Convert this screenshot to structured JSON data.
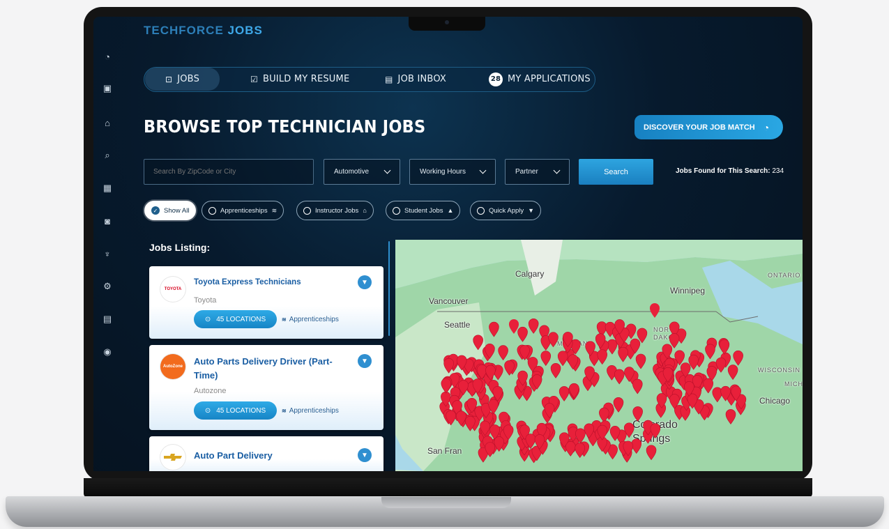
{
  "app": {
    "brand_prefix": "TECHFORCE",
    "brand_suffix": "JOBS"
  },
  "tabs": [
    {
      "label": "JOBS",
      "icon": "briefcase-icon",
      "active": true
    },
    {
      "label": "BUILD MY RESUME",
      "icon": "resume-edit-icon"
    },
    {
      "label": "JOB INBOX",
      "icon": "message-icon"
    },
    {
      "label": "MY APPLICATIONS",
      "badge": "28"
    }
  ],
  "page": {
    "title": "BROWSE TOP TECHNICIAN JOBS",
    "match_button": "DISCOVER YOUR JOB MATCH"
  },
  "filters": {
    "search_placeholder": "Search By ZipCode or City",
    "category": "Automotive",
    "hours": "Working Hours",
    "partner": "Partner",
    "search_button": "Search",
    "found_label": "Jobs Found for This Search:",
    "found_count": "234"
  },
  "chips": [
    {
      "label": "Show All",
      "active": true
    },
    {
      "label": "Apprenticeships"
    },
    {
      "label": "Instructor Jobs"
    },
    {
      "label": "Student Jobs"
    },
    {
      "label": "Quick Apply"
    }
  ],
  "listing": {
    "title": "Jobs Listing:",
    "jobs": [
      {
        "title": "Toyota Express Technicians",
        "company": "Toyota",
        "locations": "45 LOCATIONS",
        "tag": "Apprenticeships",
        "logo_text": "TOYOTA"
      },
      {
        "title": "Auto Parts Delivery Driver (Part-Time)",
        "company": "Autozone",
        "locations": "45 LOCATIONS",
        "tag": "Apprenticeships",
        "logo_text": "AutoZone"
      },
      {
        "title": "Auto Part Delivery",
        "company": "",
        "locations": "",
        "tag": "",
        "logo_text": ""
      }
    ]
  },
  "map": {
    "labels": [
      "Calgary",
      "Winnipeg",
      "Vancouver",
      "Seattle",
      "MONTANA",
      "NORTH DAKOTA",
      "WISCONSIN",
      "MICH",
      "Chicago",
      "San Fran",
      "Colorado Springs",
      "ONTARIO"
    ],
    "marker_color": "#e8203a"
  },
  "colors": {
    "accent": "#2aa7e3",
    "bg": "#071a2d",
    "marker": "#e8203a"
  }
}
